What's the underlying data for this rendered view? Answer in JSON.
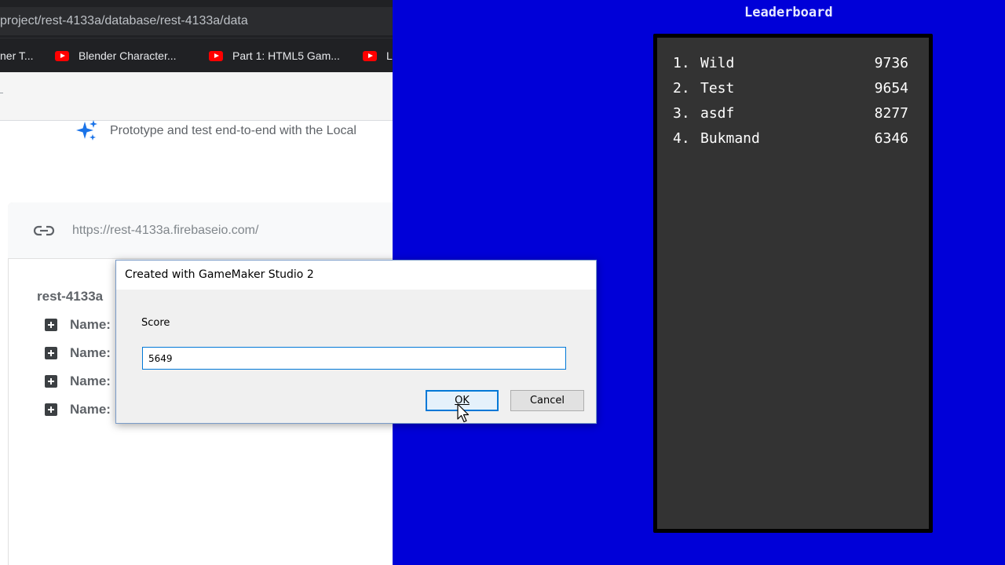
{
  "browser": {
    "address_url": "project/rest-4133a/database/rest-4133a/data",
    "bookmarks": [
      {
        "label": "ner T...",
        "icon": "none"
      },
      {
        "label": "Blender Character...",
        "icon": "youtube-icon"
      },
      {
        "label": "Part 1: HTML5 Gam...",
        "icon": "youtube-icon"
      },
      {
        "label": "L",
        "icon": "youtube-icon"
      }
    ],
    "promo_text": "Prototype and test end-to-end with the Local",
    "db_url": "https://rest-4133a.firebaseio.com/",
    "db_root": "rest-4133a",
    "tree_items": [
      {
        "label": "Name:"
      },
      {
        "label": "Name:"
      },
      {
        "label": "Name:"
      },
      {
        "label": "Name:"
      }
    ]
  },
  "dialog": {
    "title": "Created with GameMaker Studio 2",
    "label": "Score",
    "input_value": "5649",
    "ok_label": "OK",
    "cancel_label": "Cancel"
  },
  "leaderboard": {
    "title": "Leaderboard",
    "entries": [
      {
        "rank": "1.",
        "name": "Wild",
        "score": "9736"
      },
      {
        "rank": "2.",
        "name": "Test",
        "score": "9654"
      },
      {
        "rank": "3.",
        "name": "asdf",
        "score": "8277"
      },
      {
        "rank": "4.",
        "name": "Bukmand",
        "score": "6346"
      }
    ]
  },
  "colors": {
    "game_background": "#0000d8",
    "leaderboard_panel": "#333333",
    "dialog_accent": "#0078d7"
  }
}
